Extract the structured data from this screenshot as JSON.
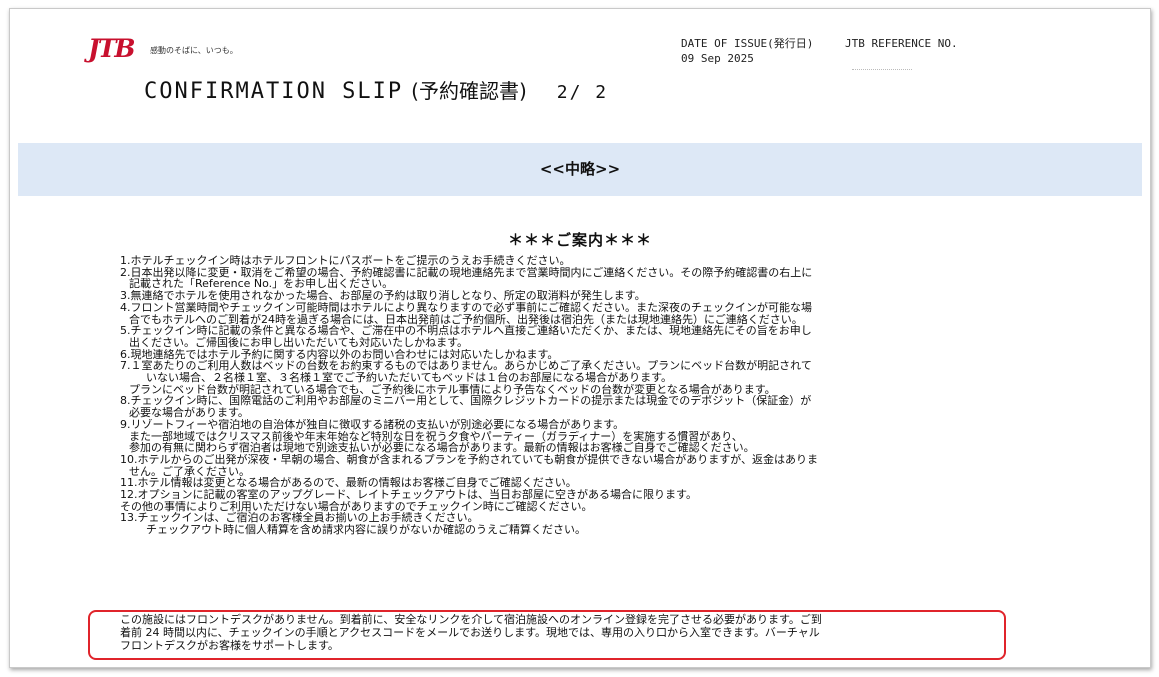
{
  "header": {
    "logo_text": "JTB",
    "logo_tagline": "感動のそばに、いつも。",
    "title": "CONFIRMATION SLIP",
    "title_jp": "(予約確認書)",
    "page": "2/ 2",
    "issue_label": "DATE OF ISSUE(発行日)",
    "issue_date": "09 Sep 2025",
    "reference_label": "JTB REFERENCE NO."
  },
  "omitted_band": "<<中略>>",
  "guide": {
    "title": "＊＊＊ご案内＊＊＊",
    "lines": [
      "1.ホテルチェックイン時はホテルフロントにパスポートをご提示のうえお手続きください。",
      "2.日本出発以降に変更・取消をご希望の場合、予約確認書に記載の現地連絡先まで営業時間内にご連絡ください。その際予約確認書の右上に",
      "記載された「Reference No.」をお申し出ください。",
      "3.無連絡でホテルを使用されなかった場合、お部屋の予約は取り消しとなり、所定の取消料が発生します。",
      "4.フロント営業時間やチェックイン可能時間はホテルにより異なりますので必ず事前にご確認ください。また深夜のチェックインが可能な場",
      "合でもホテルへのご到着が24時を過ぎる場合には、日本出発前はご予約個所、出発後は宿泊先（または現地連絡先）にご連絡ください。",
      "5.チェックイン時に記載の条件と異なる場合や、ご滞在中の不明点はホテルへ直接ご連絡いただくか、または、現地連絡先にその旨をお申し",
      "出ください。ご帰国後にお申し出いただいても対応いたしかねます。",
      "6.現地連絡先ではホテル予約に関する内容以外のお問い合わせには対応いたしかねます。",
      "7.１室あたりのご利用人数はベッドの台数をお約束するものではありません。あらかじめご了承ください。プランにベッド台数が明記されて",
      "いない場合、２名様１室、３名様１室でご予約いただいてもベッドは１台のお部屋になる場合があります。",
      "プランにベッド台数が明記されている場合でも、ご予約後にホテル事情により予告なくベッドの台数が変更となる場合があります。",
      "8.チェックイン時に、国際電話のご利用やお部屋のミニバー用として、国際クレジットカードの提示または現金でのデポジット（保証金）が",
      "必要な場合があります。",
      "9.リゾートフィーや宿泊地の自治体が独自に徴収する諸税の支払いが別途必要になる場合があります。",
      "また一部地域ではクリスマス前後や年末年始など特別な日を祝う夕食やパーティー（ガラディナー）を実施する慣習があり、",
      "参加の有無に関わらず宿泊者は現地で別途支払いが必要になる場合があります。最新の情報はお客様ご自身でご確認ください。",
      "10.ホテルからのご出発が深夜・早朝の場合、朝食が含まれるプランを予約されていても朝食が提供できない場合がありますが、返金はありま",
      "せん。ご了承ください。",
      "11.ホテル情報は変更となる場合があるので、最新の情報はお客様ご自身でご確認ください。",
      "12.オプションに記載の客室のアップグレード、レイトチェックアウトは、当日お部屋に空きがある場合に限ります。",
      "その他の事情によりご利用いただけない場合がありますのでチェックイン時にご確認ください。",
      "13.チェックインは、ご宿泊のお客様全員お揃いの上お手続きください。",
      "チェックアウト時に個人精算を含め請求内容に誤りがないか確認のうえご精算ください。"
    ]
  },
  "notice": {
    "lines": [
      "この施設にはフロントデスクがありません。到着前に、安全なリンクを介して宿泊施設へのオンライン登録を完了させる必要があります。ご到",
      "着前 24 時間以内に、チェックインの手順とアクセスコードをメールでお送りします。現地では、専用の入り口から入室できます。バーチャル",
      "フロントデスクがお客様をサポートします。"
    ],
    "border_color": "#e0242b"
  }
}
